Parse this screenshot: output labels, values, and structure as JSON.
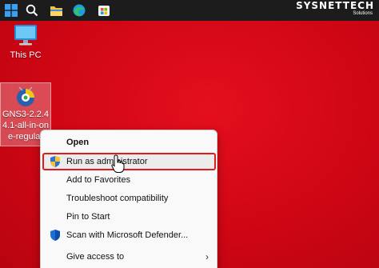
{
  "taskbar": {
    "icons": [
      "windows-start-icon",
      "search-icon",
      "file-explorer-icon",
      "edge-browser-icon",
      "microsoft-store-icon"
    ]
  },
  "watermark": {
    "brand": "SYSNETTECH",
    "sub": "Solutions"
  },
  "desktop": {
    "this_pc_label": "This PC",
    "gns3_label": "GNS3-2.2.44.1-all-in-one-regular"
  },
  "context_menu": {
    "items": [
      {
        "label": "Open",
        "bold": true
      },
      {
        "label": "Run as administrator",
        "icon": "uac-shield-icon"
      },
      {
        "label": "Add to Favorites"
      },
      {
        "label": "Troubleshoot compatibility"
      },
      {
        "label": "Pin to Start"
      },
      {
        "label": "Scan with Microsoft Defender...",
        "icon": "defender-shield-icon"
      },
      {
        "label": "Give access to",
        "submenu": true
      }
    ]
  },
  "colors": {
    "desktop_background": "#d10a16",
    "highlight_border": "#e11a1a",
    "taskbar": "#1c1c1c"
  }
}
